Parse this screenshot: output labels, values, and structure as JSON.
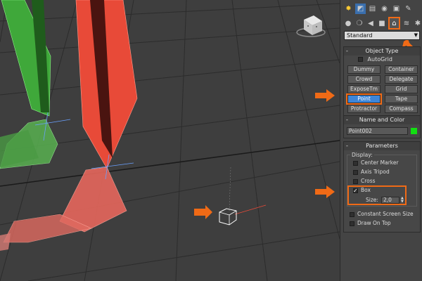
{
  "panel": {
    "tabs_row1": [
      "create-tab",
      "modify-tab",
      "hierarchy-tab",
      "motion-tab",
      "display-tab",
      "utilities-tab"
    ],
    "tabs_row2": [
      "geometry-tab",
      "shapes-tab",
      "lights-tab",
      "cameras-tab",
      "helpers-tab",
      "spacewarps-tab",
      "systems-tab"
    ],
    "category_dropdown": "Standard",
    "object_type": {
      "title": "Object Type",
      "autogrid_label": "AutoGrid",
      "buttons": [
        "Dummy",
        "Container",
        "Crowd",
        "Delegate",
        "ExposeTm",
        "Grid",
        "Point",
        "Tape",
        "Protractor",
        "Compass"
      ],
      "selected": "Point"
    },
    "name_color": {
      "title": "Name and Color",
      "name_value": "Point002",
      "color": "#12e012"
    },
    "parameters": {
      "title": "Parameters",
      "display_label": "Display:",
      "options": [
        {
          "label": "Center Marker",
          "checked": false
        },
        {
          "label": "Axis Tripod",
          "checked": false
        },
        {
          "label": "Cross",
          "checked": false
        },
        {
          "label": "Box",
          "checked": true
        }
      ],
      "size_label": "Size:",
      "size_value": "2,0",
      "constant_label": "Constant Screen Size",
      "draw_on_top_label": "Draw On Top"
    }
  },
  "colors": {
    "highlight": "#f06a16",
    "selected_button": "#3d85d8",
    "object_green": "#12e012"
  }
}
